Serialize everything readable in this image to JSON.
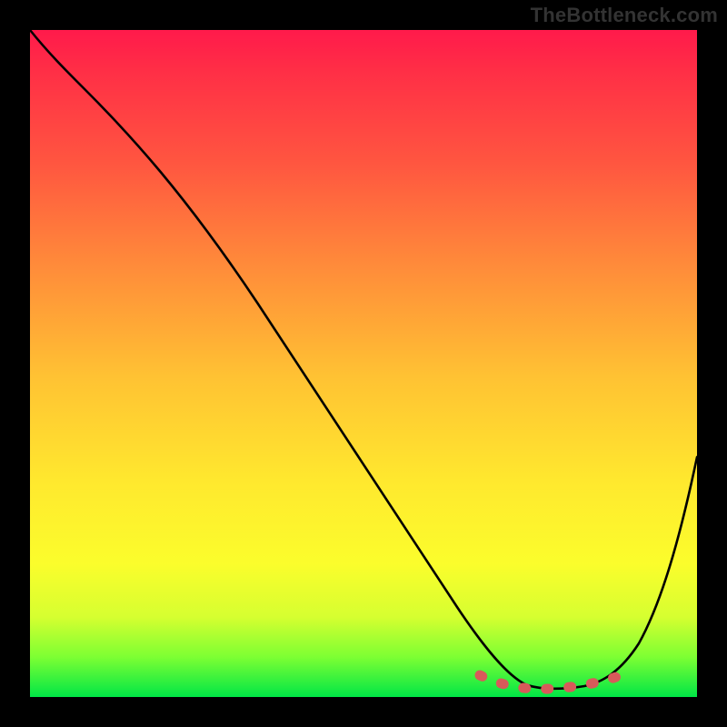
{
  "attribution": "TheBottleneck.com",
  "chart_data": {
    "type": "line",
    "title": "",
    "xlabel": "",
    "ylabel": "",
    "xlim": [
      0,
      100
    ],
    "ylim": [
      0,
      100
    ],
    "series": [
      {
        "name": "curve",
        "x": [
          0,
          3,
          8,
          15,
          25,
          35,
          45,
          55,
          62,
          68,
          72,
          75,
          80,
          85,
          90,
          95,
          100
        ],
        "y": [
          100,
          97,
          93,
          87,
          74,
          60,
          47,
          33,
          22,
          11,
          5,
          2,
          1.5,
          2,
          5,
          18,
          38
        ]
      }
    ],
    "highlight_range_x": [
      68,
      90
    ],
    "highlight_color": "#d85a5a",
    "gradient_stops": [
      {
        "pct": 0,
        "color": "#ff1a4b"
      },
      {
        "pct": 20,
        "color": "#ff5640"
      },
      {
        "pct": 52,
        "color": "#ffc233"
      },
      {
        "pct": 80,
        "color": "#fbfd2c"
      },
      {
        "pct": 100,
        "color": "#00e646"
      }
    ]
  }
}
